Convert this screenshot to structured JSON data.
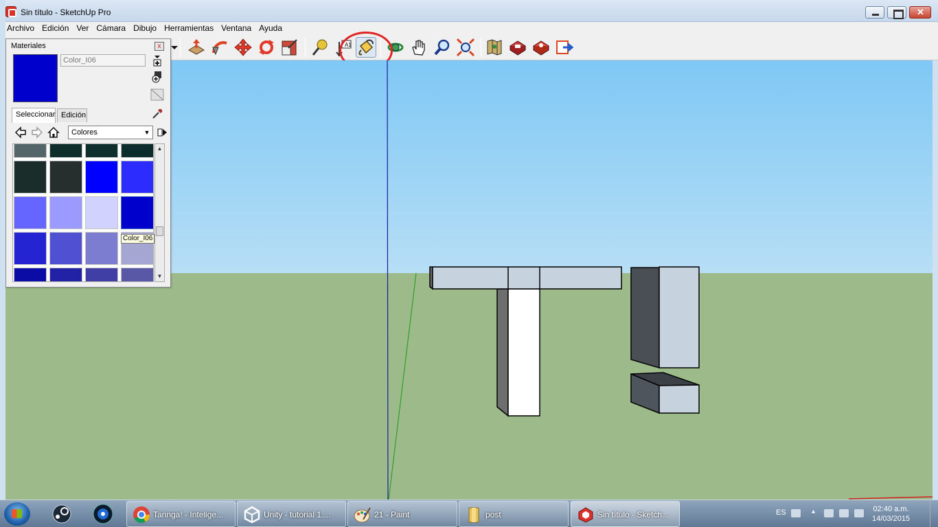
{
  "window": {
    "title": "Sin título - SketchUp Pro",
    "brand_color": "#d8322a"
  },
  "menu": [
    "Archivo",
    "Edición",
    "Ver",
    "Cámara",
    "Dibujo",
    "Herramientas",
    "Ventana",
    "Ayuda"
  ],
  "toolbar": {
    "tools": [
      {
        "name": "push-pull-icon"
      },
      {
        "name": "follow-me-icon"
      },
      {
        "name": "move-icon"
      },
      {
        "name": "rotate-icon"
      },
      {
        "name": "scale-icon"
      },
      {
        "name": "tape-measure-icon"
      },
      {
        "name": "dimension-text-icon"
      },
      {
        "name": "paint-bucket-icon",
        "active": true
      },
      {
        "name": "orbit-icon"
      },
      {
        "name": "pan-icon"
      },
      {
        "name": "zoom-icon"
      },
      {
        "name": "zoom-extents-icon"
      },
      {
        "name": "map-location-icon"
      },
      {
        "name": "warehouse-icon"
      },
      {
        "name": "components-warehouse-icon"
      },
      {
        "name": "share-model-icon"
      }
    ],
    "highlight_color": "#e02424"
  },
  "materials": {
    "title": "Materiales",
    "close_label": "x",
    "current_name": "Color_I06",
    "current_color": "#0000cc",
    "tabs": [
      "Seleccionar",
      "Edición"
    ],
    "collection": "Colores",
    "swatches": [
      [
        "#54666a",
        "#0e2e2c",
        "#0f2f2f",
        "#0c2b2c"
      ],
      [
        "#1b2d2a",
        "#262f2e",
        "#0000ff",
        "#2c2cff"
      ],
      [
        "#6565ff",
        "#9b9bff",
        "#d2d2ff",
        "#0000cc"
      ],
      [
        "#2424d2",
        "#5050d2",
        "#7c7cd0",
        "#a6a6d2"
      ],
      [
        "#0b0ba6",
        "#2222a6",
        "#3f3fa6",
        "#5858a6"
      ]
    ],
    "tooltip": "Color_I06"
  },
  "taskbar": {
    "pinned": [
      "steam-icon",
      "media-center-icon"
    ],
    "tasks": [
      {
        "label": "Taringa! - Intelige...",
        "icon": "chrome-icon"
      },
      {
        "label": "Unity - tutorial 1....",
        "icon": "unity-icon"
      },
      {
        "label": "21 - Paint",
        "icon": "paint-icon"
      },
      {
        "label": "post",
        "icon": "folder-icon"
      },
      {
        "label": "Sin título - Sketch...",
        "icon": "sketchup-icon",
        "active": true
      }
    ],
    "language": "ES",
    "time": "02:40 a.m.",
    "date": "14/03/2015"
  }
}
